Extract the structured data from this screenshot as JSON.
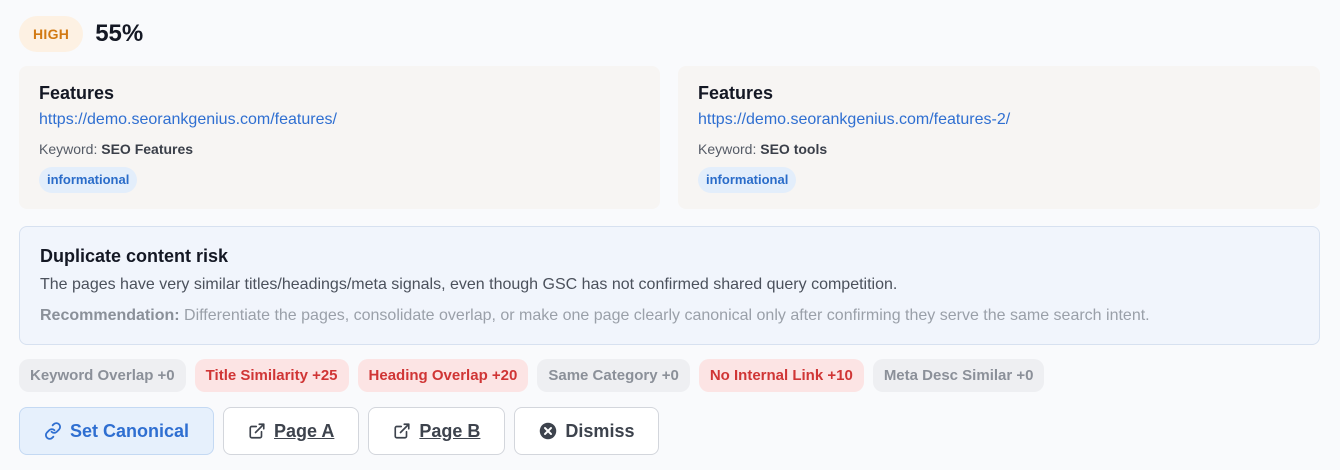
{
  "header": {
    "risk_level": "HIGH",
    "score": "55%"
  },
  "pages": [
    {
      "title": "Features",
      "url": "https://demo.seorankgenius.com/features/",
      "keyword_label": "Keyword:",
      "keyword": "SEO Features",
      "intent": "informational"
    },
    {
      "title": "Features",
      "url": "https://demo.seorankgenius.com/features-2/",
      "keyword_label": "Keyword:",
      "keyword": "SEO tools",
      "intent": "informational"
    }
  ],
  "risk": {
    "title": "Duplicate content risk",
    "description": "The pages have very similar titles/headings/meta signals, even though GSC has not confirmed shared query competition.",
    "recommendation_label": "Recommendation:",
    "recommendation": "Differentiate the pages, consolidate overlap, or make one page clearly canonical only after confirming they serve the same search intent."
  },
  "signals": [
    {
      "label": "Keyword Overlap +0",
      "status": "neutral"
    },
    {
      "label": "Title Similarity +25",
      "status": "bad"
    },
    {
      "label": "Heading Overlap +20",
      "status": "bad"
    },
    {
      "label": "Same Category +0",
      "status": "neutral"
    },
    {
      "label": "No Internal Link +10",
      "status": "bad"
    },
    {
      "label": "Meta Desc Similar +0",
      "status": "neutral"
    }
  ],
  "actions": {
    "set_canonical": {
      "label": "Set Canonical",
      "icon": "link-icon"
    },
    "page_a": {
      "label": "Page A",
      "icon": "external-link-icon"
    },
    "page_b": {
      "label": "Page B",
      "icon": "external-link-icon"
    },
    "dismiss": {
      "label": "Dismiss",
      "icon": "close-circle-icon"
    }
  },
  "colors": {
    "accent": "#2f6fd1",
    "high_risk": "#d27a13",
    "bad": "#d03535"
  }
}
